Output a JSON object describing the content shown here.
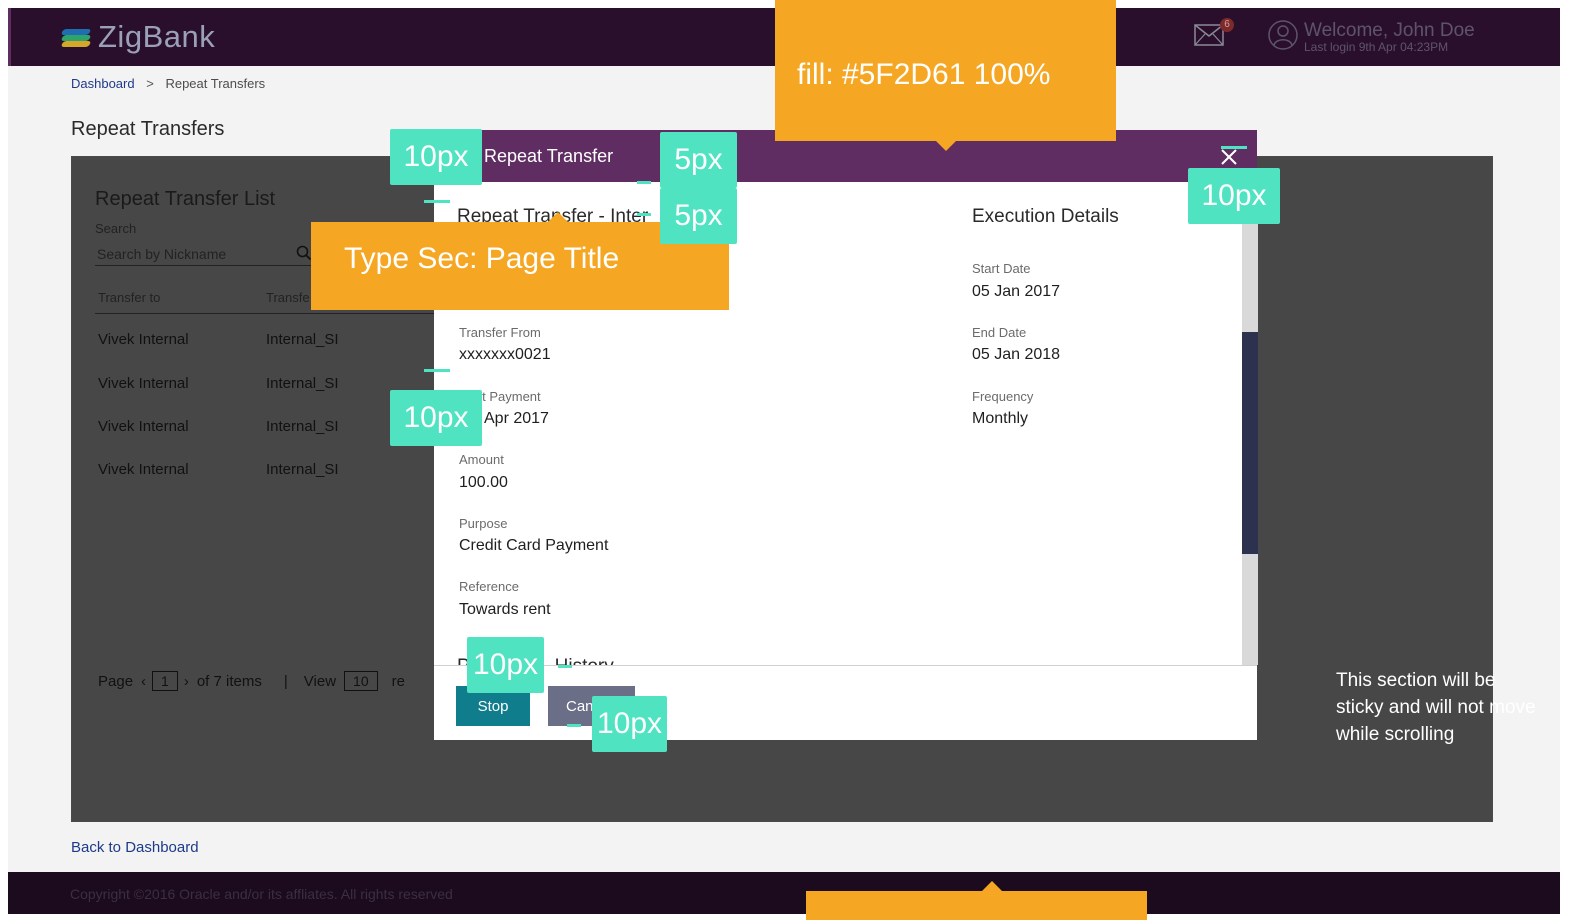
{
  "header": {
    "logo_text": "ZigBank",
    "mail_badge": "6",
    "welcome": "Welcome, John Doe",
    "last_login": "Last login 9th Apr 04:23PM"
  },
  "breadcrumb": {
    "home": "Dashboard",
    "separator": ">",
    "current": "Repeat Transfers"
  },
  "page_title": "Repeat Transfers",
  "list": {
    "title": "Repeat Transfer List",
    "search_label": "Search",
    "search_placeholder": "Search by Nickname",
    "columns": [
      "Transfer to",
      "Transfe"
    ],
    "rows": [
      [
        "Vivek Internal",
        "Internal_SI"
      ],
      [
        "Vivek Internal",
        "Internal_SI"
      ],
      [
        "Vivek Internal",
        "Internal_SI"
      ],
      [
        "Vivek Internal",
        "Internal_SI"
      ]
    ],
    "pager": {
      "page_label": "Page",
      "page": "1",
      "of_text": "of 7 items",
      "divider": "|",
      "view_label": "View",
      "view": "10",
      "trailing": "re"
    }
  },
  "back_link": "Back to Dashboard",
  "footer_text": "Copyright ©2016 Oracle and/or its affliates. All rights reserved",
  "modal": {
    "title": "ew Repeat Transfer",
    "section_left": "Repeat Transfer - Inter",
    "section_right": "Execution Details",
    "fields_left": [
      {
        "label": "Transfer From",
        "value": "xxxxxxx0021"
      },
      {
        "label": "Next Payment",
        "value": "Apr 2017"
      },
      {
        "label": "Amount",
        "value": "100.00"
      },
      {
        "label": "Purpose",
        "value": "Credit Card Payment"
      },
      {
        "label": "Reference",
        "value": "Towards rent"
      }
    ],
    "fields_right": [
      {
        "label": "Start Date",
        "value": "05 Jan 2017"
      },
      {
        "label": "End Date",
        "value": "05 Jan 2018"
      },
      {
        "label": "Frequency",
        "value": "Monthly"
      }
    ],
    "history_title": "P",
    "history_title_rest": "History",
    "buttons": {
      "stop": "Stop",
      "cancel": "Can"
    }
  },
  "annotations": {
    "fill_note": "fill: #5F2D61 100%",
    "type_note": "Type Sec: Page Title",
    "sticky_note": "This section will be sticky and will not move while scrolling",
    "spacing": [
      "10px",
      "5px",
      "5px",
      "10px",
      "10px",
      "10px",
      "10px"
    ]
  },
  "colors": {
    "header_bg": "#2a0f2c",
    "modal_header": "#5F2D61",
    "stop_button": "#0f7d8c",
    "cancel_button": "#6a6e86",
    "annotation_orange": "#f5a623",
    "annotation_green": "#50e3c2"
  }
}
